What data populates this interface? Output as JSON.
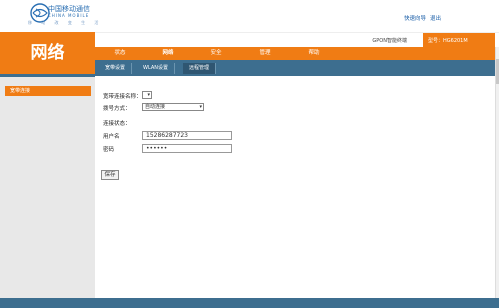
{
  "brand": {
    "name": "中国移动通信",
    "sub": "CHINA MOBILE",
    "sub2": "移 动 改 变 生 活"
  },
  "top_links": [
    "快速向导",
    "退出"
  ],
  "gpon": {
    "label": "GPON智能终端",
    "model": "型号：HG6201M"
  },
  "section_title": "网络",
  "main_tabs": [
    "状态",
    "网络",
    "安全",
    "管理",
    "帮助"
  ],
  "sub_tabs": [
    "宽带设置",
    "WLAN设置",
    "远程管理"
  ],
  "sidebar_items": [
    "宽带连接"
  ],
  "form": {
    "conn_name_label": "宽带连接名称：",
    "dial_label": "拨号方式：",
    "dial_value": "自动连接",
    "status_label": "连接状态：",
    "username_label": "用户名",
    "username_value": "15286287723",
    "password_label": "密码",
    "password_value": "••••••",
    "save_label": "保存"
  }
}
